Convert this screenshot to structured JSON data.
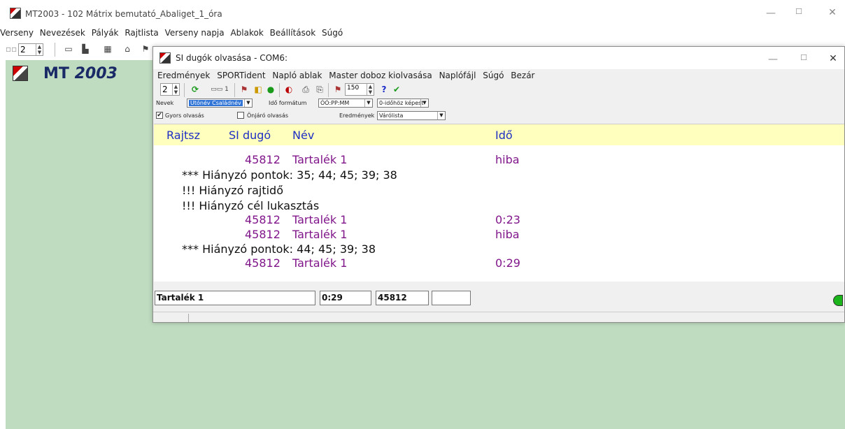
{
  "main_window": {
    "title": "MT2003  -  102 Mátrix bemutató_Abaliget_1_óra",
    "menu": [
      "Verseny",
      "Nevezések",
      "Pályák",
      "Rajtlista",
      "Verseny napja",
      "Ablakok",
      "Beállítások",
      "Súgó"
    ],
    "toolbar": {
      "spin_value": "2"
    },
    "logo": {
      "prefix": "MT",
      "suffix": "2003"
    },
    "controls": {
      "minimize": "—",
      "maximize": "☐",
      "close": "✕"
    }
  },
  "dialog": {
    "title": "SI dugók olvasása - COM6:",
    "menu": [
      "Eredmények",
      "SPORTident",
      "Napló ablak",
      "Master doboz kiolvasása",
      "Naplófájl",
      "Súgó",
      "Bezár"
    ],
    "toolbar": {
      "spin_value": "2",
      "counter_label": "1",
      "spin2_value": "150"
    },
    "options": {
      "nevek_label": "Nevek",
      "nevek_value": "Utónév Családnév",
      "ido_formatum_label": "Idő formátum",
      "ido_formatum_value": "ÓÓ:PP:MM",
      "idohoz_value": "0-időhöz képest",
      "gyors_olvasas": "Gyors olvasás",
      "gyors_checked": "✔",
      "onjaro_olvasas": "Önjáró olvasás",
      "eredmenyek_label": "Eredmények",
      "eredmenyek_value": "Várólista"
    },
    "grid": {
      "headers": {
        "rajtsz": "Rajtsz",
        "si_dugo": "SI dugó",
        "nev": "Név",
        "ido": "Idő"
      },
      "rows": [
        {
          "si": "45812",
          "name": "Tartalék 1",
          "time": "hiba"
        },
        {
          "msg": "*** Hiányzó pontok: 35; 44; 45; 39; 38"
        },
        {
          "msg": "!!! Hiányzó rajtidő"
        },
        {
          "msg": "!!! Hiányzó cél lukasztás"
        },
        {
          "si": "45812",
          "name": "Tartalék 1",
          "time": "0:23"
        },
        {
          "si": "45812",
          "name": "Tartalék 1",
          "time": "hiba"
        },
        {
          "msg": "*** Hiányzó pontok: 44; 45; 39; 38"
        },
        {
          "si": "45812",
          "name": "Tartalék 1",
          "time": "0:29"
        }
      ]
    },
    "status": {
      "name": "Tartalék 1",
      "time": "0:29",
      "si": "45812",
      "extra": ""
    },
    "controls": {
      "minimize": "—",
      "maximize": "☐",
      "close": "✕"
    }
  }
}
